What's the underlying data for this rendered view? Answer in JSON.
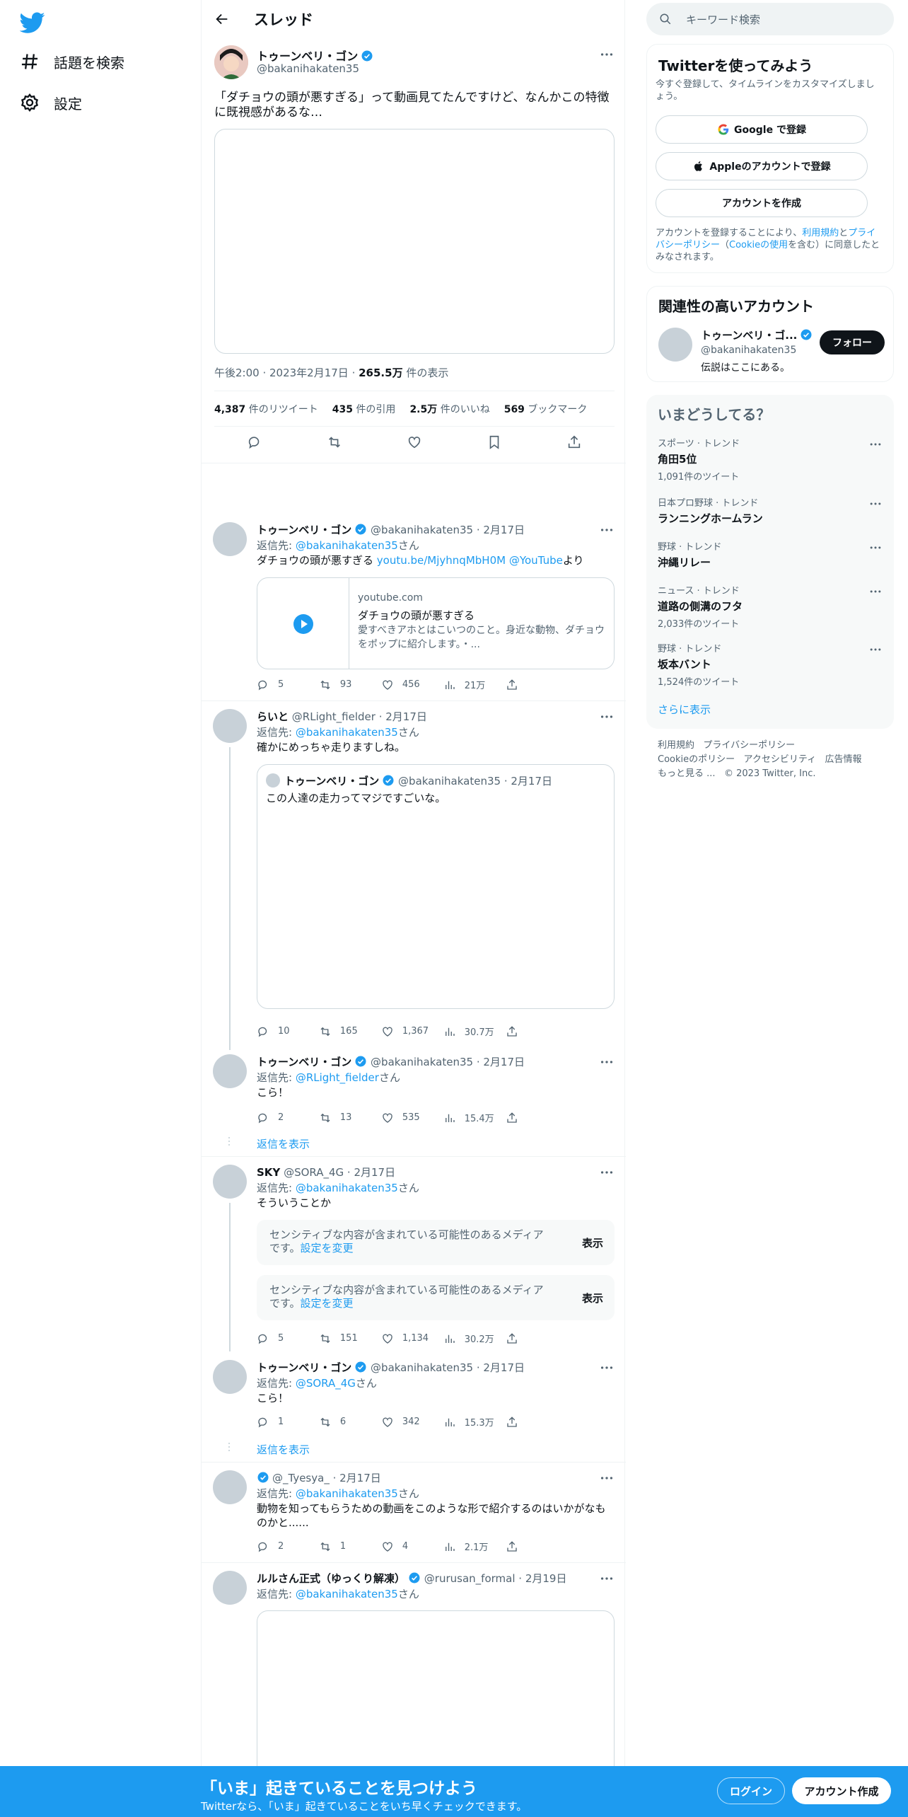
{
  "nav": {
    "explore_label": "話題を検索",
    "settings_label": "設定"
  },
  "header": {
    "title": "スレッド"
  },
  "main_tweet": {
    "name": "トゥーンベリ・ゴン",
    "handle": "@bakanihakaten35",
    "text": "「ダチョウの頭が悪すぎる」って動画見てたんですけど、なんかこの特徴に既視感があるな…",
    "time": "午後2:00",
    "date": "2023年2月17日",
    "views": "265.5万",
    "views_label": "件の表示",
    "retweets": "4,387",
    "retweets_label": "件のリツイート",
    "quotes": "435",
    "quotes_label": "件の引用",
    "likes": "2.5万",
    "likes_label": "件のいいね",
    "bookmarks": "569",
    "bookmarks_label": "ブックマーク"
  },
  "replies": [
    {
      "name": "トゥーンベリ・ゴン",
      "handle": "@bakanihakaten35",
      "date": "2月17日",
      "reply_prefix": "返信先: ",
      "reply_to": "@bakanihakaten35",
      "reply_suffix": "さん",
      "text_before": "ダチョウの頭が悪すぎる ",
      "link": "youtu.be/MjyhnqMbH0M",
      "mention": " @YouTube",
      "text_after": "より",
      "card": {
        "domain": "youtube.com",
        "title": "ダチョウの頭が悪すぎる",
        "desc": "愛すべきアホとはこいつのこと。身近な動物、ダチョウをポップに紹介します。・..."
      },
      "replies": "5",
      "retweets": "93",
      "likes": "456",
      "views": "21万"
    },
    {
      "name": "らいと",
      "handle": "@RLight_fielder",
      "date": "2月17日",
      "reply_prefix": "返信先: ",
      "reply_to": "@bakanihakaten35",
      "reply_suffix": "さん",
      "text": "確かにめっちゃ走りますしね。",
      "quote": {
        "name": "トゥーンベリ・ゴン",
        "handle": "@bakanihakaten35",
        "date": "2月17日",
        "text": "この人達の走力ってマジですごいな。"
      },
      "replies": "10",
      "retweets": "165",
      "likes": "1,367",
      "views": "30.7万"
    },
    {
      "name": "トゥーンベリ・ゴン",
      "handle": "@bakanihakaten35",
      "date": "2月17日",
      "reply_prefix": "返信先: ",
      "reply_to": "@RLight_fielder",
      "reply_suffix": "さん",
      "text": "こら！",
      "replies": "2",
      "retweets": "13",
      "likes": "535",
      "views": "15.4万"
    },
    {
      "name": "SKY",
      "handle": "@SORA_4G",
      "date": "2月17日",
      "reply_prefix": "返信先: ",
      "reply_to": "@bakanihakaten35",
      "reply_suffix": "さん",
      "text": "そういうことか",
      "sensitive_text": "センシティブな内容が含まれている可能性のあるメディアです。",
      "sensitive_link": "設定を変更",
      "sensitive_button": "表示",
      "replies": "5",
      "retweets": "151",
      "likes": "1,134",
      "views": "30.2万"
    },
    {
      "name": "トゥーンベリ・ゴン",
      "handle": "@bakanihakaten35",
      "date": "2月17日",
      "reply_prefix": "返信先: ",
      "reply_to": "@SORA_4G",
      "reply_suffix": "さん",
      "text": "こら！",
      "replies": "1",
      "retweets": "6",
      "likes": "342",
      "views": "15.3万"
    },
    {
      "name": "",
      "handle": "@_Tyesya_",
      "date": "2月17日",
      "reply_prefix": "返信先: ",
      "reply_to": "@bakanihakaten35",
      "reply_suffix": "さん",
      "text": "動物を知ってもらうための動画をこのような形で紹介するのはいかがなものかと......",
      "replies": "2",
      "retweets": "1",
      "likes": "4",
      "views": "2.1万"
    },
    {
      "name": "ルルさん正式（ゆっくり解凍）",
      "handle": "@rurusan_formal",
      "date": "2月19日",
      "reply_prefix": "返信先: ",
      "reply_to": "@bakanihakaten35",
      "reply_suffix": "さん"
    }
  ],
  "show_replies": "返信を表示",
  "search": {
    "placeholder": "キーワード検索"
  },
  "signup_box": {
    "title": "Twitterを使ってみよう",
    "subtitle": "今すぐ登録して、タイムラインをカスタマイズしましょう。",
    "google": "Google で登録",
    "apple": "Appleのアカウントで登録",
    "create": "アカウントを作成",
    "legal_1": "アカウントを登録することにより、",
    "terms": "利用規約",
    "legal_2": "と",
    "privacy": "プライバシーポリシー",
    "legal_3": "（",
    "cookie": "Cookieの使用",
    "legal_4": "を含む）に同意したとみなされます。"
  },
  "related": {
    "title": "関連性の高いアカウント",
    "name": "トゥーンベリ・ゴ...",
    "handle": "@bakanihakaten35",
    "bio": "伝説はここにある。",
    "follow": "フォロー"
  },
  "trends": {
    "title": "いまどうしてる？",
    "items": [
      {
        "category": "スポーツ · トレンド",
        "name": "角田5位",
        "count": "1,091件のツイート"
      },
      {
        "category": "日本プロ野球 · トレンド",
        "name": "ランニングホームラン",
        "count": ""
      },
      {
        "category": "野球 · トレンド",
        "name": "沖縄リレー",
        "count": ""
      },
      {
        "category": "ニュース · トレンド",
        "name": "道路の側溝のフタ",
        "count": "2,033件のツイート"
      },
      {
        "category": "野球 · トレンド",
        "name": "坂本バント",
        "count": "1,524件のツイート"
      }
    ],
    "show_more": "さらに表示"
  },
  "footer": {
    "terms": "利用規約",
    "privacy": "プライバシーポリシー",
    "cookie": "Cookieのポリシー",
    "accessibility": "アクセシビリティ",
    "ads": "広告情報",
    "more": "もっと見る ...",
    "copyright": "© 2023 Twitter, Inc."
  },
  "banner": {
    "headline": "「いま」起きていることを見つけよう",
    "sub": "Twitterなら、「いま」起きていることをいち早くチェックできます。",
    "login": "ログイン",
    "signup": "アカウント作成"
  },
  "colors": {
    "accent": "#1d9bf0",
    "text": "#0f1419",
    "secondary": "#536471",
    "border": "#eff3f4"
  }
}
